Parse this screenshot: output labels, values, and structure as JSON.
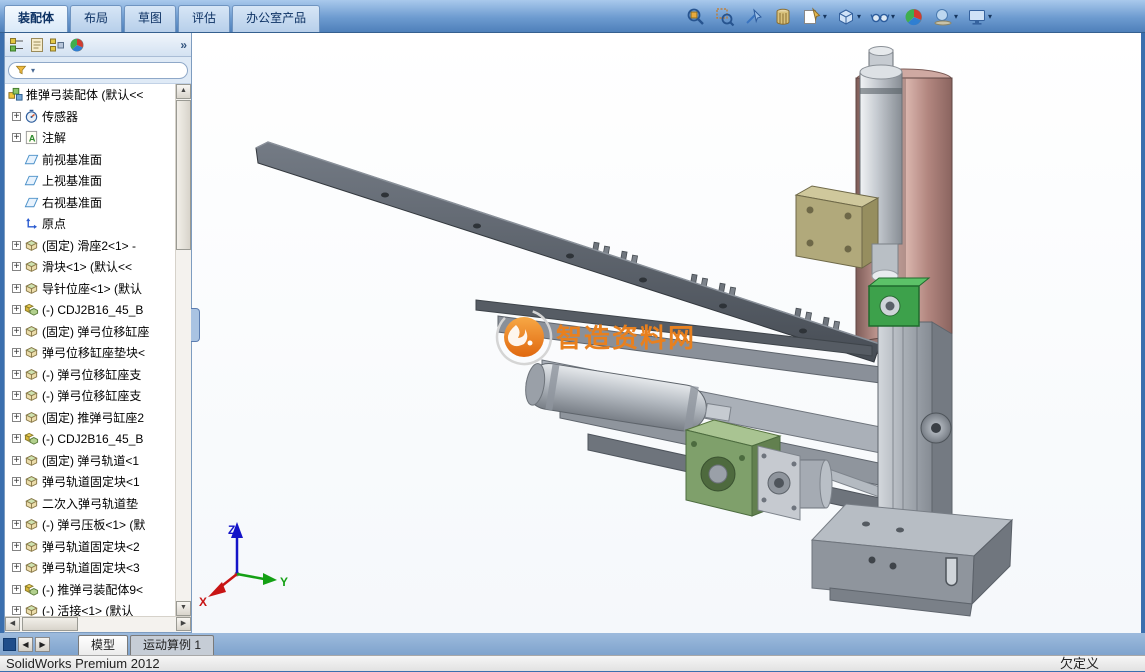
{
  "ribbon": {
    "tabs": [
      {
        "label": "装配体",
        "active": true
      },
      {
        "label": "布局",
        "active": false
      },
      {
        "label": "草图",
        "active": false
      },
      {
        "label": "评估",
        "active": false
      },
      {
        "label": "办公室产品",
        "active": false
      }
    ]
  },
  "view_toolbar": {
    "buttons": [
      {
        "name": "zoom-fit",
        "dropdown": false
      },
      {
        "name": "zoom-area",
        "dropdown": false
      },
      {
        "name": "previous-view",
        "dropdown": false
      },
      {
        "name": "section-view",
        "dropdown": false
      },
      {
        "name": "drawing-view",
        "dropdown": true
      },
      {
        "name": "view-orientation",
        "dropdown": true
      },
      {
        "name": "hide-show-items",
        "dropdown": true
      },
      {
        "name": "edit-appearance",
        "dropdown": false
      },
      {
        "name": "apply-scene",
        "dropdown": true
      },
      {
        "name": "view-settings",
        "dropdown": true
      }
    ]
  },
  "panel": {
    "toolbar": [
      {
        "name": "featuremanager-tree"
      },
      {
        "name": "property-manager"
      },
      {
        "name": "configuration-manager"
      },
      {
        "name": "display-manager"
      },
      {
        "name": "overflow",
        "label": "»"
      }
    ],
    "tree": {
      "root": "推弹弓装配体 (默认<<",
      "root_icon": "assembly-root",
      "items": [
        {
          "expand": true,
          "icon": "sensor",
          "label": "传感器"
        },
        {
          "expand": true,
          "icon": "annotation",
          "label": "注解"
        },
        {
          "expand": false,
          "icon": "plane",
          "label": "前视基准面"
        },
        {
          "expand": false,
          "icon": "plane",
          "label": "上视基准面"
        },
        {
          "expand": false,
          "icon": "plane",
          "label": "右视基准面"
        },
        {
          "expand": false,
          "icon": "origin",
          "label": "原点"
        },
        {
          "expand": true,
          "icon": "part",
          "label": "(固定) 滑座2<1> -"
        },
        {
          "expand": true,
          "icon": "part",
          "label": "滑块<1> (默认<<"
        },
        {
          "expand": true,
          "icon": "part",
          "label": "导针位座<1> (默认"
        },
        {
          "expand": true,
          "icon": "assembly",
          "label": "(-) CDJ2B16_45_B"
        },
        {
          "expand": true,
          "icon": "part",
          "label": "(固定) 弹弓位移缸座"
        },
        {
          "expand": true,
          "icon": "part",
          "label": "弹弓位移缸座垫块<"
        },
        {
          "expand": true,
          "icon": "part",
          "label": "(-) 弹弓位移缸座支"
        },
        {
          "expand": true,
          "icon": "part",
          "label": "(-) 弹弓位移缸座支"
        },
        {
          "expand": true,
          "icon": "part",
          "label": "(固定) 推弹弓缸座2"
        },
        {
          "expand": true,
          "icon": "assembly",
          "label": "(-) CDJ2B16_45_B"
        },
        {
          "expand": true,
          "icon": "part",
          "label": "(固定) 弹弓轨道<1"
        },
        {
          "expand": true,
          "icon": "part",
          "label": "弹弓轨道固定块<1"
        },
        {
          "expand": false,
          "icon": "part",
          "label": "二次入弹弓轨道垫"
        },
        {
          "expand": true,
          "icon": "part",
          "label": "(-) 弹弓压板<1> (默"
        },
        {
          "expand": true,
          "icon": "part",
          "label": "弹弓轨道固定块<2"
        },
        {
          "expand": true,
          "icon": "part",
          "label": "弹弓轨道固定块<3"
        },
        {
          "expand": true,
          "icon": "assembly",
          "label": "(-) 推弹弓装配体9<"
        },
        {
          "expand": true,
          "icon": "part",
          "label": "(-) 活接<1> (默认"
        }
      ]
    }
  },
  "viewport": {
    "watermark": "智造资料网",
    "triad": {
      "x": "X",
      "y": "Y",
      "z": "Z"
    }
  },
  "bottom_bar": {
    "tabs": [
      {
        "label": "模型",
        "active": true
      },
      {
        "label": "运动算例 1",
        "active": false
      }
    ]
  },
  "status_bar": {
    "left": "SolidWorks Premium 2012",
    "right": "欠定义"
  },
  "colors": {
    "frame_blue": "#3b6fae",
    "watermark_orange": "#e8801e",
    "axis_x": "#c81414",
    "axis_y": "#14a014",
    "axis_z": "#1414c8"
  }
}
